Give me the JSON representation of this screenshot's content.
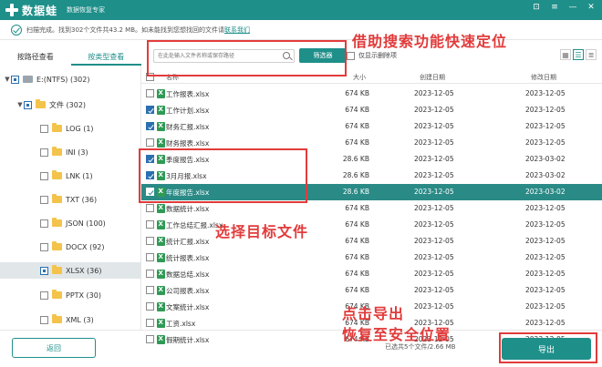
{
  "app": {
    "name": "数据蛙",
    "subtitle": "数据恢复专家",
    "win_buttons": [
      "⊡",
      "≡",
      "—",
      "✕"
    ]
  },
  "status": {
    "text": "扫描完成。找到302个文件共43.2 MB。如未能找到您想找回的文件请",
    "link": "联系我们"
  },
  "sidebar": {
    "tabs": [
      {
        "label": "按路径查看",
        "active": false
      },
      {
        "label": "按类型查看",
        "active": true
      }
    ],
    "tree": [
      {
        "label": "E:(NTFS) (302)",
        "arrow": "▼",
        "type": "drive",
        "check": "partial"
      },
      {
        "label": "文件 (302)",
        "arrow": "▼",
        "type": "folder",
        "check": "partial"
      },
      {
        "label": "LOG (1)",
        "arrow": "",
        "type": "folder",
        "check": "none"
      },
      {
        "label": "INI (3)",
        "arrow": "",
        "type": "folder",
        "check": "none"
      },
      {
        "label": "LNK (1)",
        "arrow": "",
        "type": "folder",
        "check": "none"
      },
      {
        "label": "TXT (36)",
        "arrow": "",
        "type": "folder",
        "check": "none"
      },
      {
        "label": "JSON (100)",
        "arrow": "",
        "type": "folder",
        "check": "none"
      },
      {
        "label": "DOCX (92)",
        "arrow": "",
        "type": "folder",
        "check": "none"
      },
      {
        "label": "XLSX (36)",
        "arrow": "",
        "type": "folder",
        "check": "partial",
        "selected": true
      },
      {
        "label": "PPTX (30)",
        "arrow": "",
        "type": "folder",
        "check": "none"
      },
      {
        "label": "XML (3)",
        "arrow": "",
        "type": "folder",
        "check": "none"
      }
    ]
  },
  "toolbar": {
    "search_placeholder": "在此处输入文件名称或保存路径",
    "filter_label": "筛选器",
    "only_deleted_label": "仅显示删除项",
    "views": [
      "▦",
      "☰",
      "≣"
    ]
  },
  "table": {
    "headers": {
      "name": "名称",
      "size": "大小",
      "created": "创建日期",
      "modified": "修改日期"
    },
    "rows": [
      {
        "name": "工作报表.xlsx",
        "size": "674 KB",
        "created": "2023-12-05",
        "modified": "2023-12-05",
        "checked": false
      },
      {
        "name": "工作计划.xlsx",
        "size": "674 KB",
        "created": "2023-12-05",
        "modified": "2023-12-05",
        "checked": true
      },
      {
        "name": "财务汇报.xlsx",
        "size": "674 KB",
        "created": "2023-12-05",
        "modified": "2023-12-05",
        "checked": true
      },
      {
        "name": "财务报表.xlsx",
        "size": "674 KB",
        "created": "2023-12-05",
        "modified": "2023-12-05",
        "checked": false
      },
      {
        "name": "季度报告.xlsx",
        "size": "28.6 KB",
        "created": "2023-12-05",
        "modified": "2023-03-02",
        "checked": true
      },
      {
        "name": "3月月报.xlsx",
        "size": "28.6 KB",
        "created": "2023-12-05",
        "modified": "2023-03-02",
        "checked": true
      },
      {
        "name": "年度报告.xlsx",
        "size": "28.6 KB",
        "created": "2023-12-05",
        "modified": "2023-03-02",
        "checked": true,
        "selected": true
      },
      {
        "name": "数据统计.xlsx",
        "size": "674 KB",
        "created": "2023-12-05",
        "modified": "2023-12-05",
        "checked": false
      },
      {
        "name": "工作总结汇报.xlsx",
        "size": "674 KB",
        "created": "2023-12-05",
        "modified": "2023-12-05",
        "checked": false
      },
      {
        "name": "统计汇报.xlsx",
        "size": "674 KB",
        "created": "2023-12-05",
        "modified": "2023-12-05",
        "checked": false
      },
      {
        "name": "统计报表.xlsx",
        "size": "674 KB",
        "created": "2023-12-05",
        "modified": "2023-12-05",
        "checked": false
      },
      {
        "name": "数据总结.xlsx",
        "size": "674 KB",
        "created": "2023-12-05",
        "modified": "2023-12-05",
        "checked": false
      },
      {
        "name": "公司报表.xlsx",
        "size": "674 KB",
        "created": "2023-12-05",
        "modified": "2023-12-05",
        "checked": false
      },
      {
        "name": "文案统计.xlsx",
        "size": "674 KB",
        "created": "2023-12-05",
        "modified": "2023-12-05",
        "checked": false
      },
      {
        "name": "工资.xlsx",
        "size": "674 KB",
        "created": "2023-12-05",
        "modified": "2023-12-05",
        "checked": false
      },
      {
        "name": "假期统计.xlsx",
        "size": "674 KB",
        "created": "2023-12-05",
        "modified": "2023-12-05",
        "checked": false
      }
    ]
  },
  "footer": {
    "back_label": "返回",
    "selected_info": "已选共5个文件/2.66 MB",
    "export_label": "导出"
  },
  "annotations": {
    "search_hint": "借助搜索功能快速定位",
    "select_hint": "选择目标文件",
    "export_hint_1": "点击导出",
    "export_hint_2": "恢复至安全位置"
  },
  "colors": {
    "accent": "#1f8f8a",
    "annotation": "#e23b3b",
    "selected_row": "#2a8a86"
  }
}
